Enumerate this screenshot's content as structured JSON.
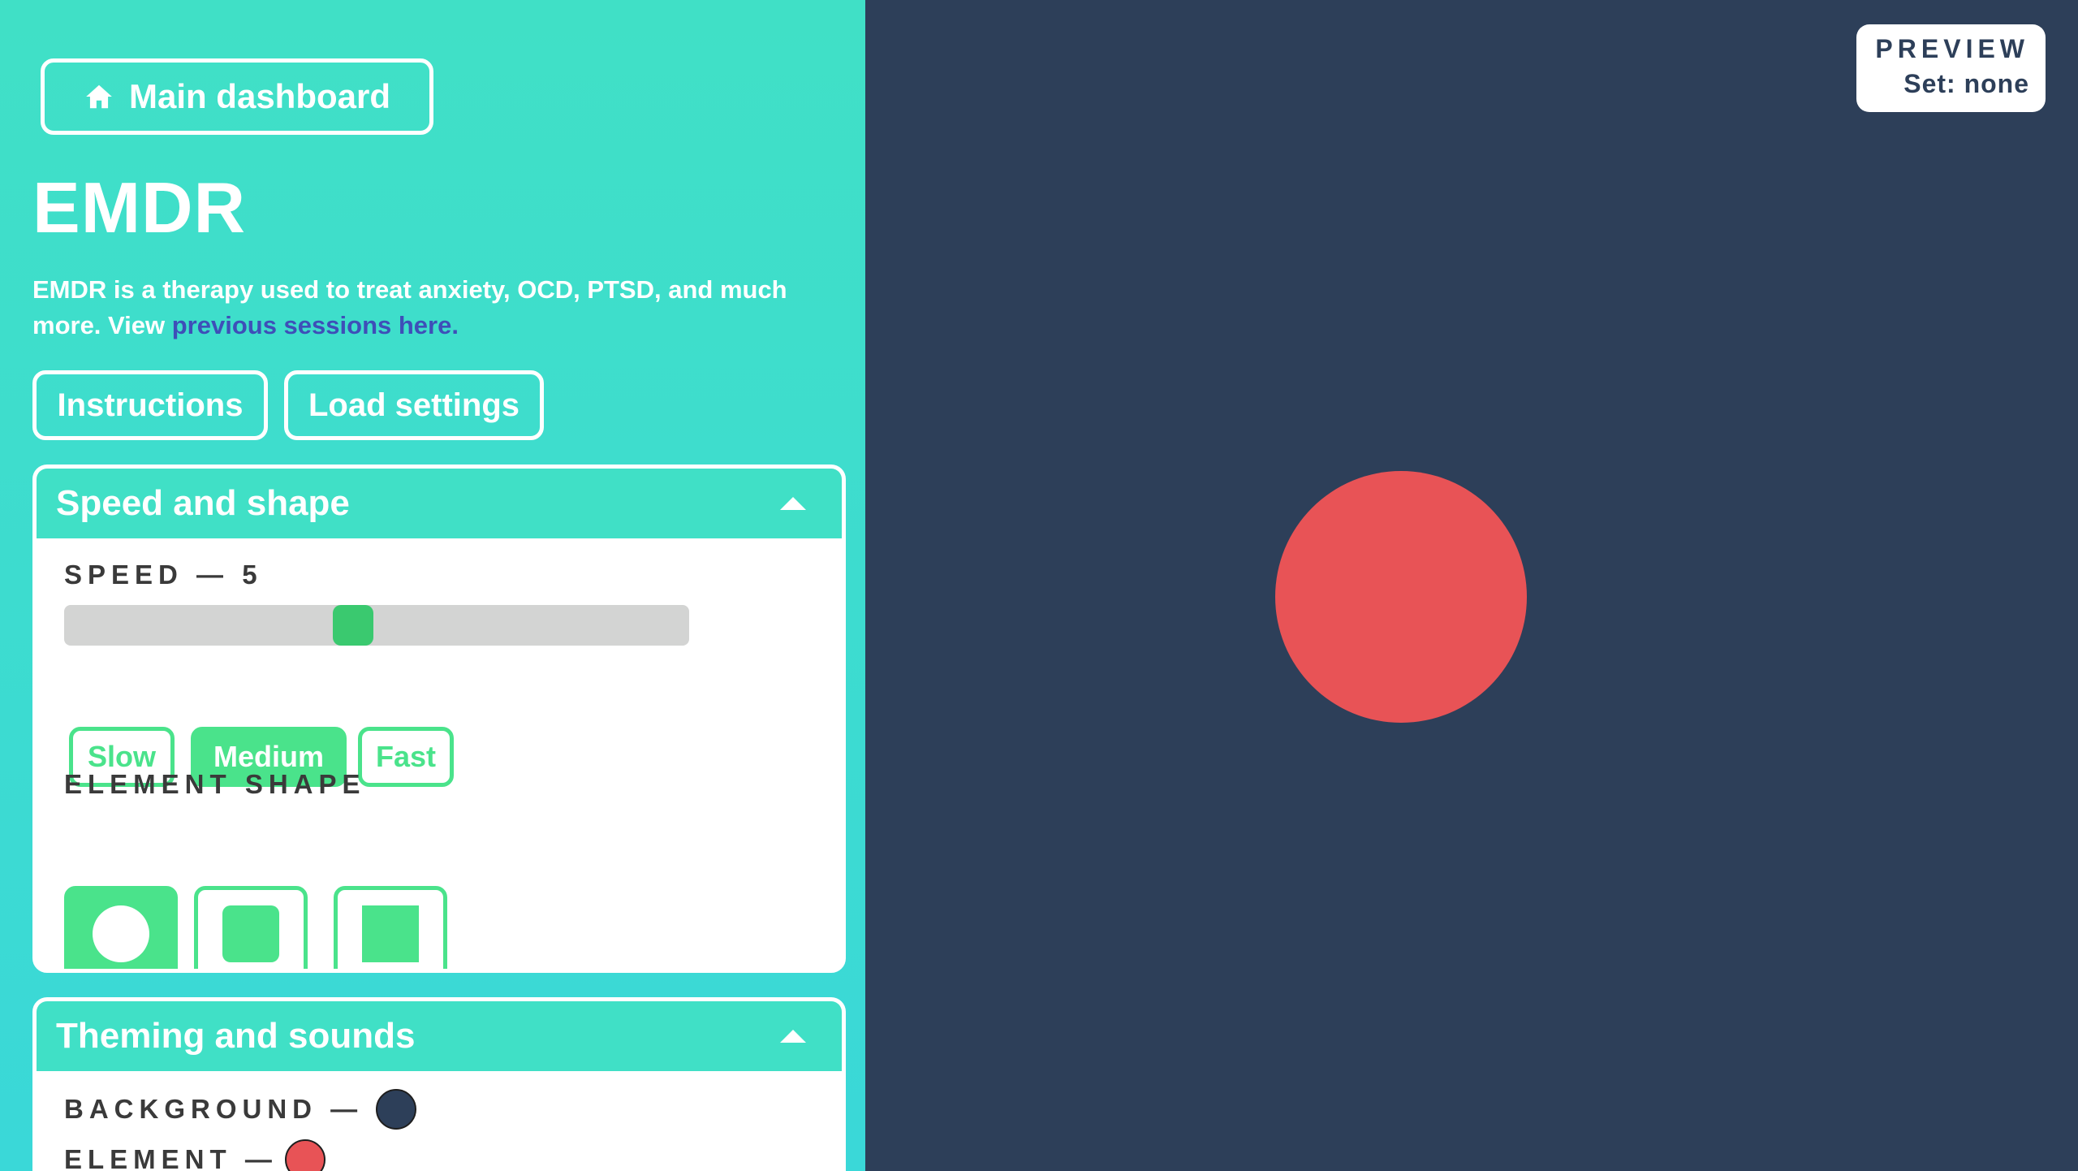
{
  "sidebar": {
    "dashboard_label": "Main dashboard",
    "title": "EMDR",
    "description_text": "EMDR is a therapy used to treat anxiety, OCD, PTSD, and much more. View ",
    "description_link": "previous sessions here.",
    "instructions_label": "Instructions",
    "load_settings_label": "Load settings"
  },
  "speed_panel": {
    "header": "Speed and shape",
    "speed_label": "SPEED — 5",
    "speed_value": 5,
    "speed_presets": [
      "Slow",
      "Medium",
      "Fast"
    ],
    "active_preset": "Medium",
    "shape_label": "ELEMENT SHAPE",
    "shapes": [
      "circle",
      "rounded-square",
      "square"
    ],
    "active_shape": "circle"
  },
  "theme_panel": {
    "header": "Theming and sounds",
    "background_label": "BACKGROUND —",
    "background_color": "#2d3f59",
    "element_label": "ELEMENT —",
    "element_color": "#e85356"
  },
  "preview": {
    "title": "PREVIEW",
    "set_label": "Set: none"
  },
  "colors": {
    "accent_green": "#4ae38b",
    "teal": "#40e0c6",
    "canvas": "#2d3f59",
    "element": "#e85356"
  }
}
